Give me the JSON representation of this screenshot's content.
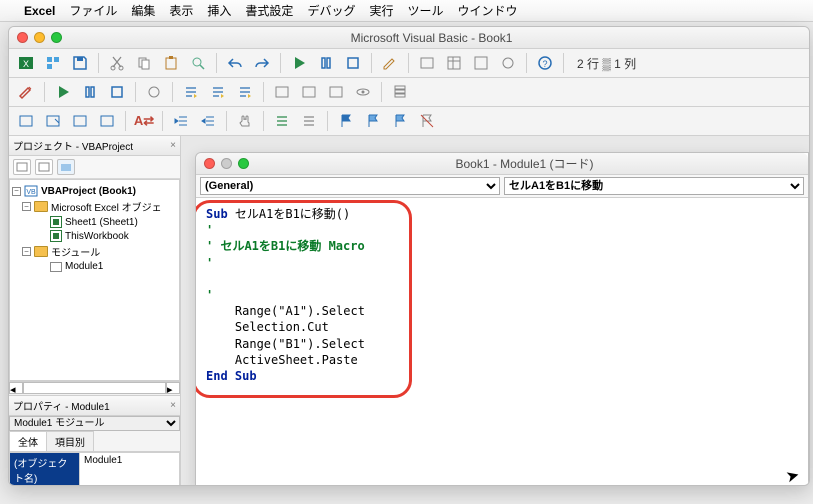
{
  "menubar": {
    "appname": "Excel",
    "items": [
      "ファイル",
      "編集",
      "表示",
      "挿入",
      "書式設定",
      "デバッグ",
      "実行",
      "ツール",
      "ウインドウ"
    ]
  },
  "window": {
    "title": "Microsoft Visual Basic - Book1",
    "status": "2 行 ▒ 1 列"
  },
  "project_pane": {
    "title": "プロジェクト - VBAProject",
    "root": "VBAProject (Book1)",
    "excel_objects": "Microsoft Excel オブジェ",
    "sheet1": "Sheet1 (Sheet1)",
    "thiswb": "ThisWorkbook",
    "modules": "モジュール",
    "module1": "Module1"
  },
  "props": {
    "title": "プロパティ - Module1",
    "selector": "Module1  モジュール",
    "tab1": "全体",
    "tab2": "項目別",
    "name_key": "(オブジェクト名)",
    "name_val": "Module1"
  },
  "codewin": {
    "title": "Book1 - Module1 (コード)",
    "general": "(General)",
    "proc": "セルA1をB1に移動"
  },
  "code": {
    "l1a": "Sub",
    "l1b": " セルA1をB1に移動()",
    "l2": "'",
    "l3": "' セルA1をB1に移動 Macro",
    "l4": "'",
    "l5": "",
    "l6": "'",
    "l7": "    Range(\"A1\").Select",
    "l8": "    Selection.Cut",
    "l9": "    Range(\"B1\").Select",
    "l10": "    ActiveSheet.Paste",
    "l11": "End Sub"
  }
}
